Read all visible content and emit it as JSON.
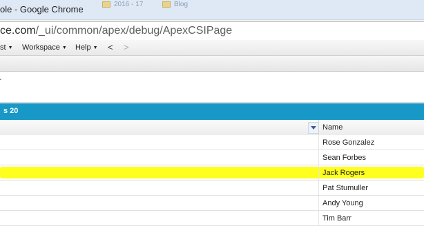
{
  "window": {
    "title": "ole - Google Chrome",
    "tabs": [
      {
        "label": "2016 - 17"
      },
      {
        "label": "Blog"
      }
    ]
  },
  "address_bar": {
    "domain": "ce.com",
    "path": "/_ui/common/apex/debug/ApexCSIPage"
  },
  "menu": {
    "partial_item": "st",
    "workspace": "Workspace",
    "help": "Help",
    "back": "<",
    "forward": ">"
  },
  "panel": {
    "fragment": "r"
  },
  "query_results": {
    "header_text": "s 20"
  },
  "grid": {
    "columns": [
      {
        "label": "Name"
      }
    ],
    "rows": [
      {
        "name": "Rose Gonzalez",
        "highlighted": false
      },
      {
        "name": "Sean Forbes",
        "highlighted": false
      },
      {
        "name": "Jack Rogers",
        "highlighted": true
      },
      {
        "name": "Pat Stumuller",
        "highlighted": false
      },
      {
        "name": "Andy Young",
        "highlighted": false
      },
      {
        "name": "Tim Barr",
        "highlighted": false
      }
    ]
  },
  "colors": {
    "result_bar": "#1798c6",
    "highlight": "#ffff1f",
    "title_bar": "#dfe9f5"
  }
}
